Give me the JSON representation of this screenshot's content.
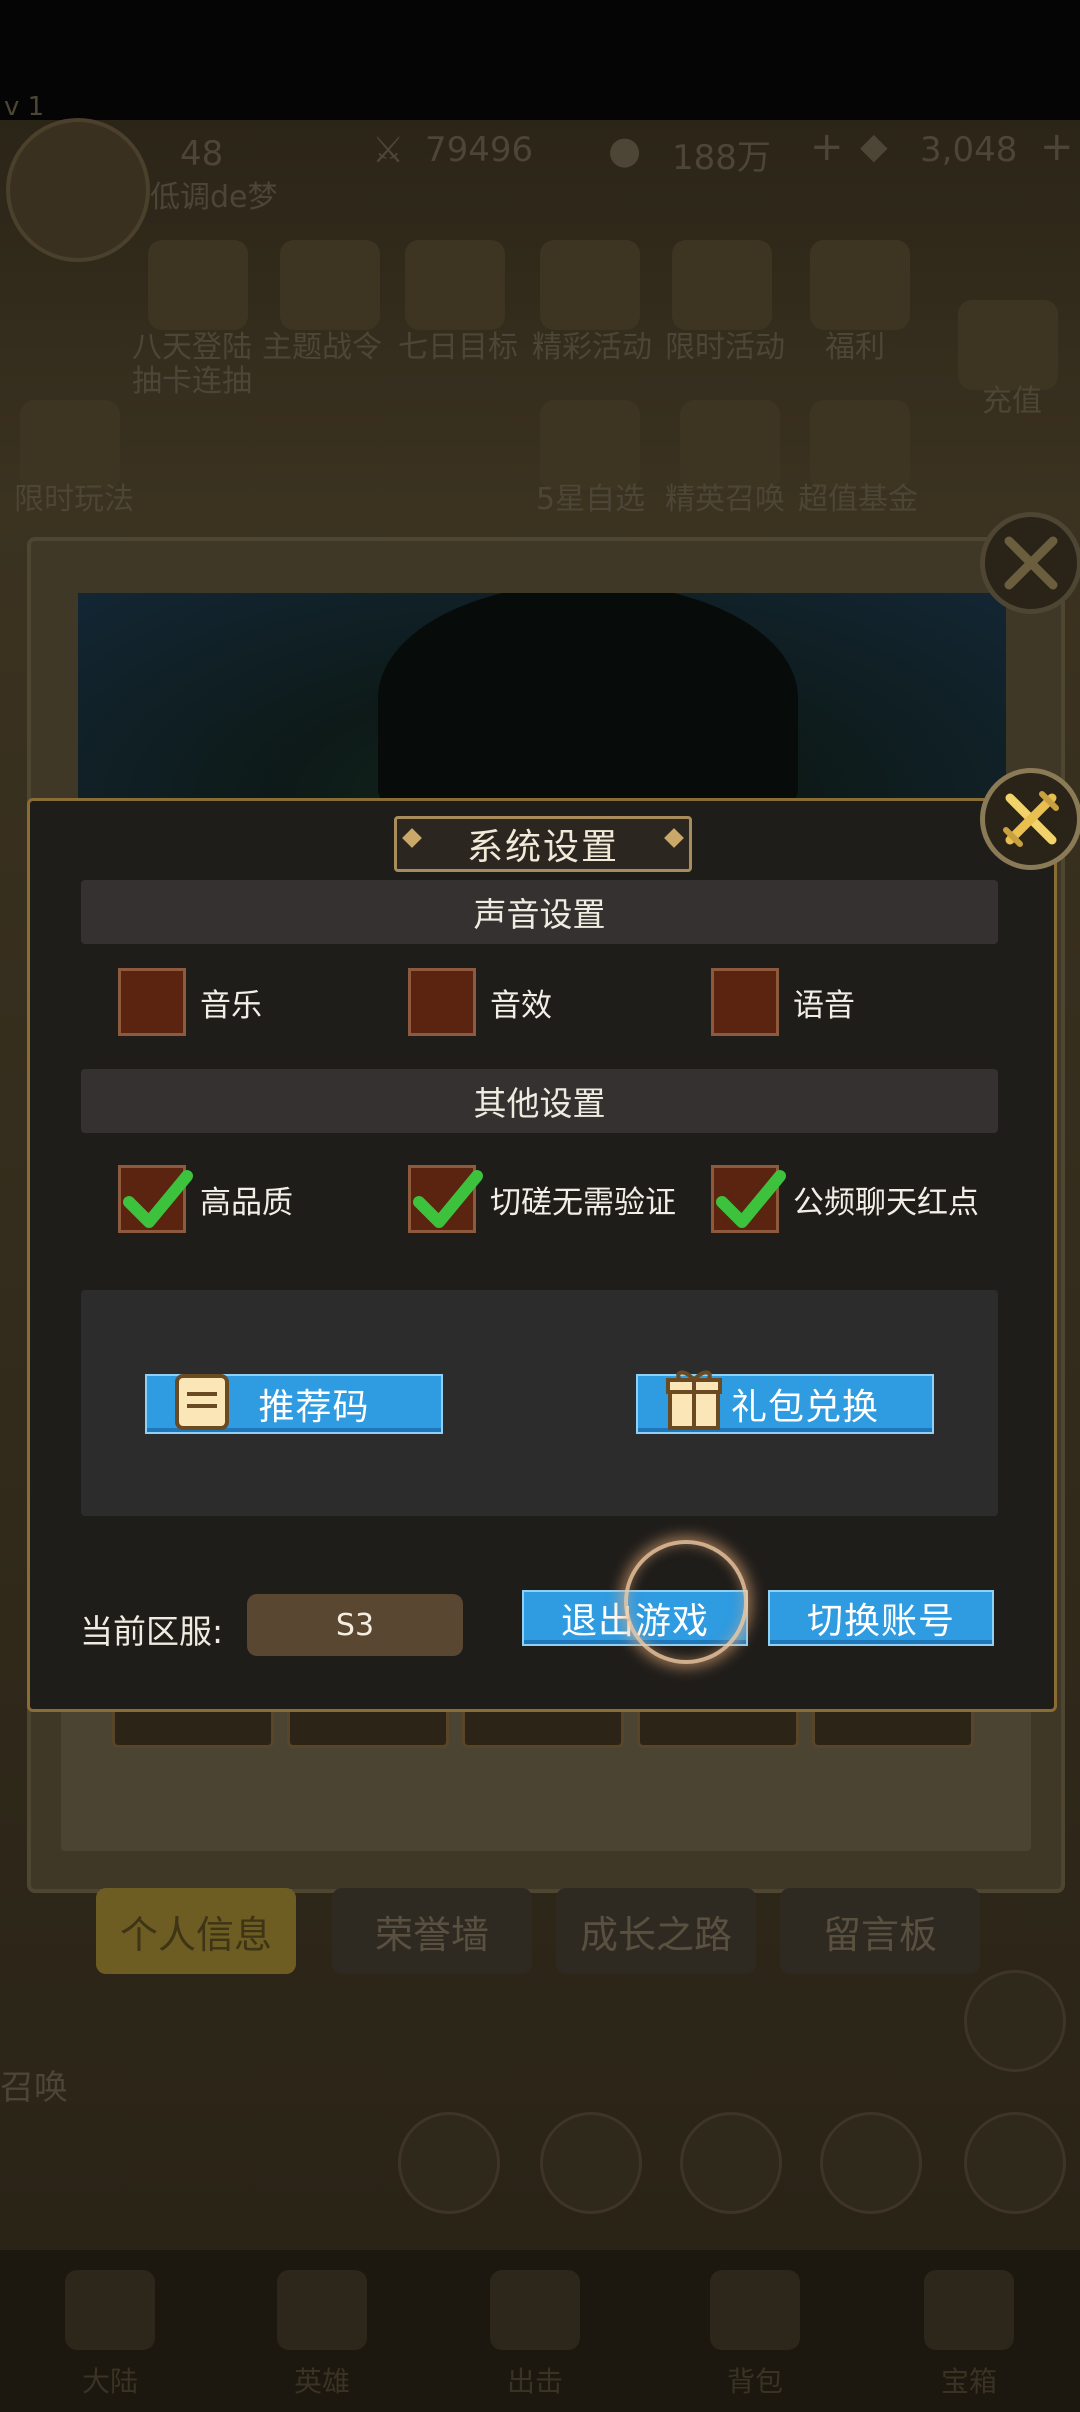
{
  "hud": {
    "level": "48",
    "player_name": "低调de梦",
    "combat_power": "79496",
    "gold": "188万",
    "gems": "3,048",
    "version_tag": "v 1"
  },
  "activities": {
    "row1": [
      "八天登陆",
      "主题战令",
      "七日目标",
      "精彩活动",
      "限时活动",
      "福利"
    ],
    "row1_sub": "抽卡连抽",
    "recharge": "充值",
    "row2": [
      "限时玩法",
      "5星自选",
      "精英召唤",
      "超值基金"
    ]
  },
  "profile_tabs": [
    "个人信息",
    "荣誉墙",
    "成长之路",
    "留言板"
  ],
  "side_label": "召唤",
  "bottom_nav": [
    "大陆",
    "英雄",
    "出击",
    "背包",
    "宝箱"
  ],
  "dialog": {
    "title": "系统设置",
    "sound_section": "声音设置",
    "sound_options": [
      {
        "label": "音乐",
        "checked": false
      },
      {
        "label": "音效",
        "checked": false
      },
      {
        "label": "语音",
        "checked": false
      }
    ],
    "other_section": "其他设置",
    "other_options": [
      {
        "label": "高品质",
        "checked": true
      },
      {
        "label": "切磋无需验证",
        "checked": true
      },
      {
        "label": "公频聊天红点",
        "checked": true
      }
    ],
    "referral_button": "推荐码",
    "gift_button": "礼包兑换",
    "server_label": "当前区服:",
    "server_value": "S3",
    "logout_button": "退出游戏",
    "switch_account_button": "切换账号"
  },
  "colors": {
    "accent_blue": "#2f9be0",
    "check_green": "#3cc23c",
    "checkbox_bg": "#5a2410",
    "dialog_border": "#8a6d35"
  }
}
